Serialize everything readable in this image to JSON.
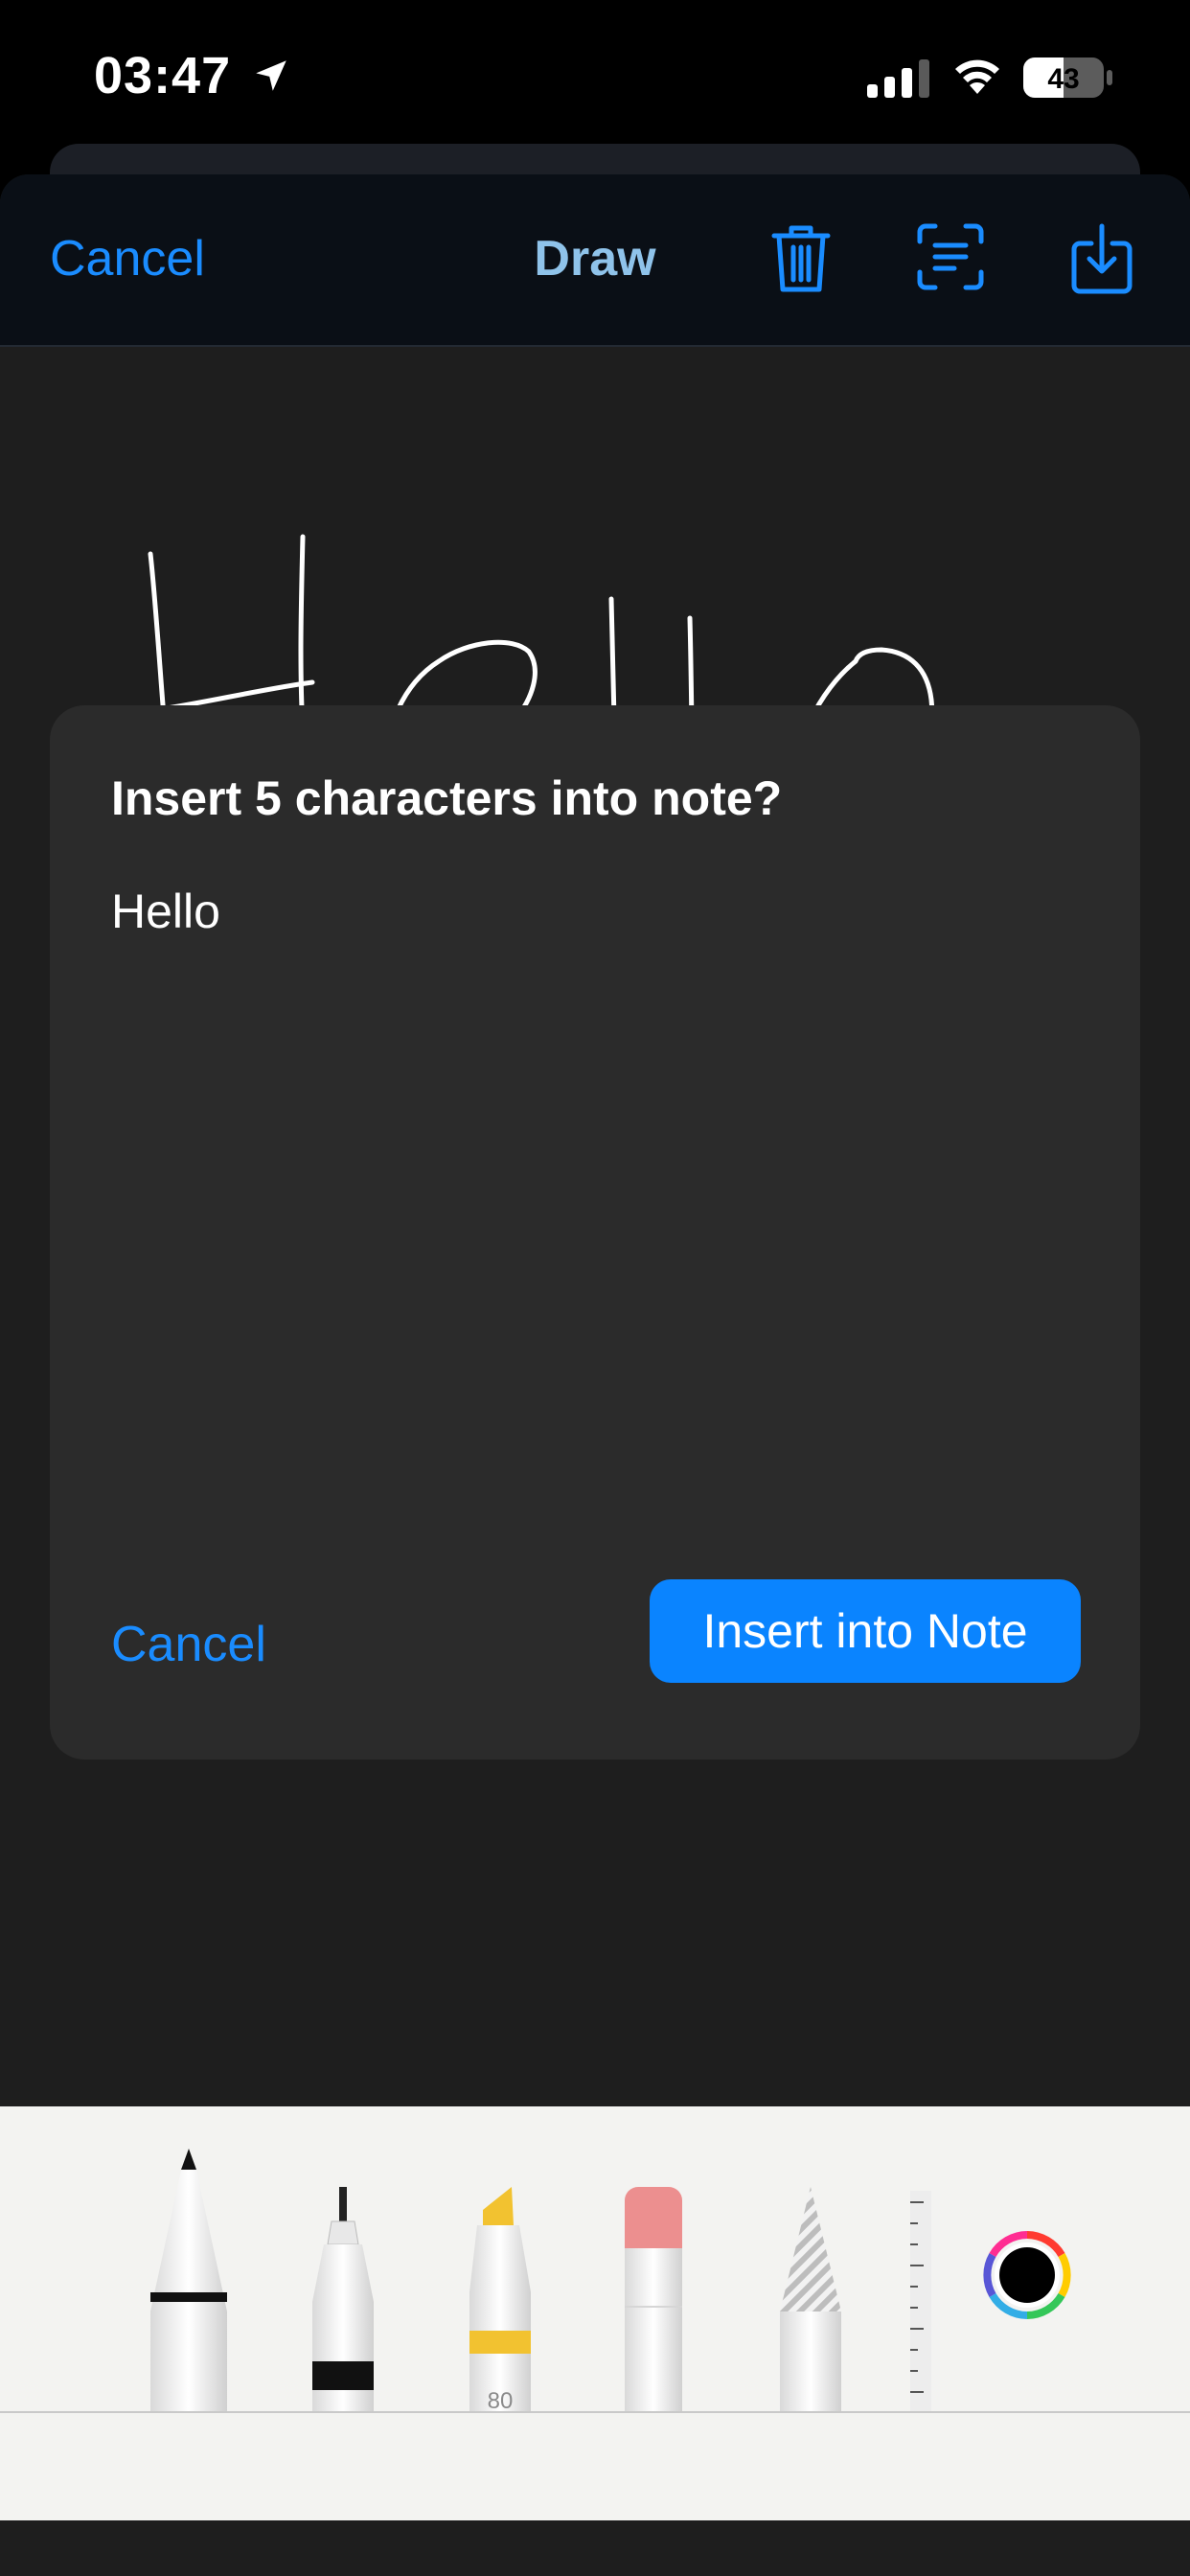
{
  "status_bar": {
    "time": "03:47",
    "battery_level": "43"
  },
  "nav": {
    "cancel_label": "Cancel",
    "title": "Draw",
    "icons": [
      "trash-icon",
      "scan-text-icon",
      "export-icon"
    ]
  },
  "drawing": {
    "handwritten_text": "Hello"
  },
  "dialog": {
    "title": "Insert 5 characters into note?",
    "preview_text": "Hello",
    "cancel_label": "Cancel",
    "insert_label": "Insert into Note"
  },
  "tools": {
    "items": [
      "pen",
      "fineliner",
      "marker",
      "eraser",
      "pencil",
      "ruler",
      "color-picker"
    ],
    "marker_width_label": "80",
    "selected_color": "#000000"
  },
  "colors": {
    "accent": "#0a84ff",
    "link": "#1a8cff",
    "nav_title": "#8fc3ea",
    "canvas_bg": "#1e1e1e",
    "dialog_bg": "#2b2b2b"
  }
}
